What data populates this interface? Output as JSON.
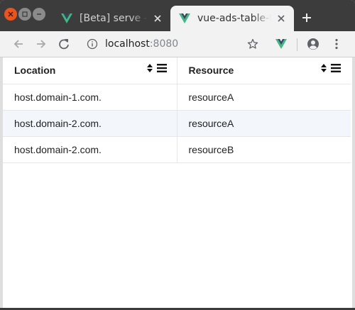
{
  "tabs": [
    {
      "title": "[Beta] serve - Pr",
      "active": false
    },
    {
      "title": "vue-ads-table-tr",
      "active": true
    }
  ],
  "address": {
    "host": "localhost",
    "port": ":8080"
  },
  "table": {
    "columns": [
      "Location",
      "Resource"
    ],
    "rows": [
      [
        "host.domain-1.com.",
        "resourceA"
      ],
      [
        "host.domain-2.com.",
        "resourceA"
      ],
      [
        "host.domain-2.com.",
        "resourceB"
      ]
    ]
  },
  "colors": {
    "vue_green": "#41b883",
    "vue_dark": "#35495e",
    "close": "#e95420"
  },
  "icons": [
    "close-icon",
    "maximize-icon",
    "minimize-icon",
    "vue-logo-icon",
    "tab-close-icon",
    "plus-icon",
    "back-arrow-icon",
    "forward-arrow-icon",
    "reload-icon",
    "info-icon",
    "star-icon",
    "vue-devtools-icon",
    "account-icon",
    "more-vert-icon",
    "sort-icon",
    "column-filter-icon"
  ]
}
